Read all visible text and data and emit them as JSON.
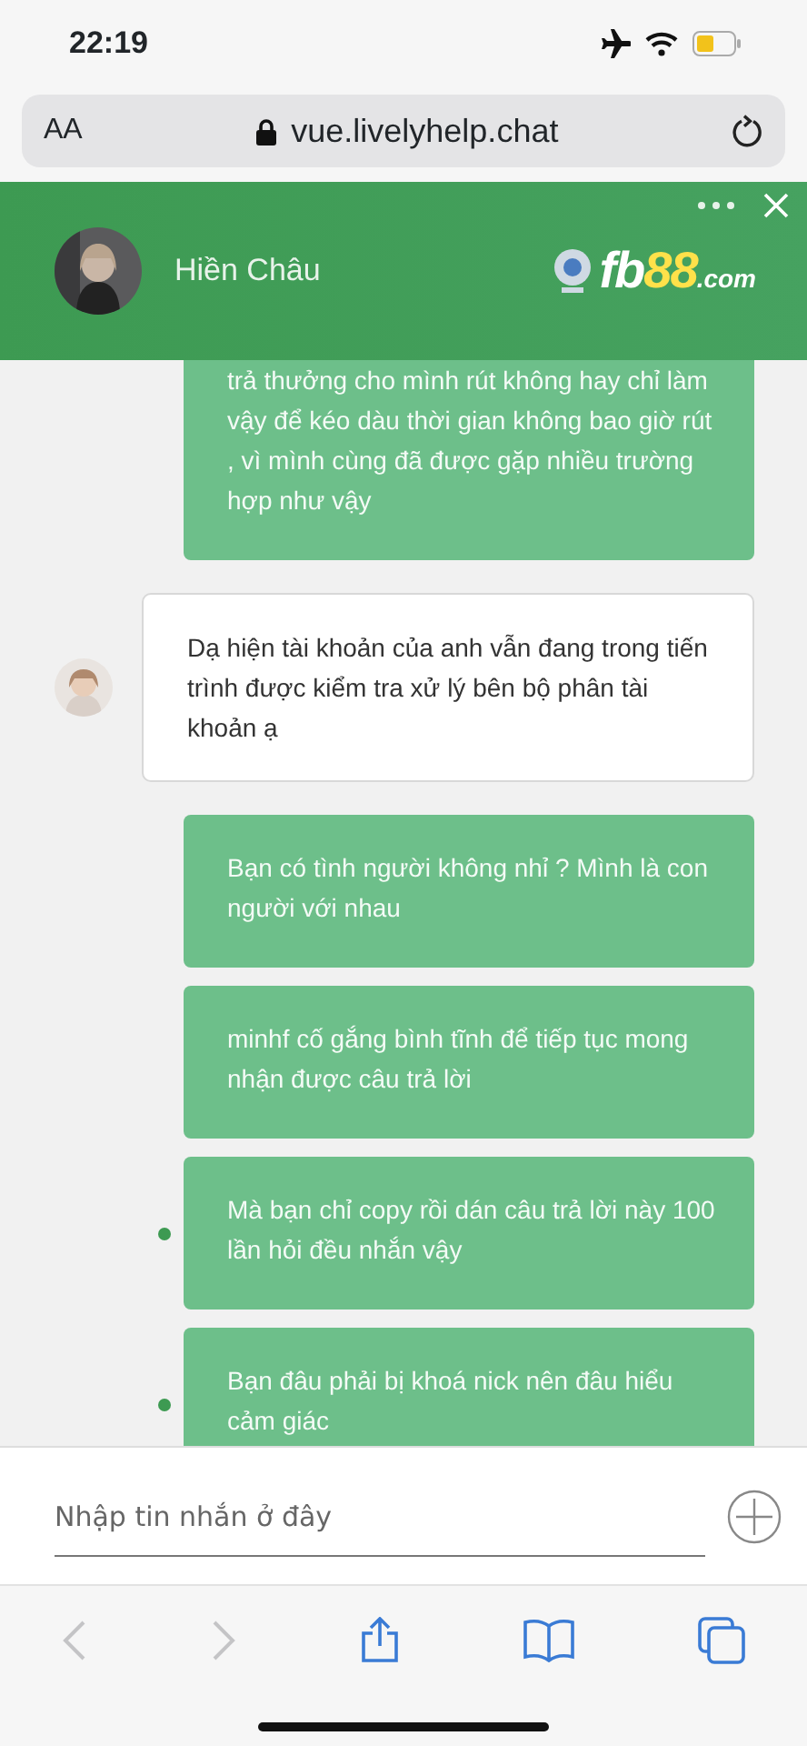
{
  "status_bar": {
    "time": "22:19"
  },
  "browser": {
    "text_size_button": "AA",
    "url": "vue.livelyhelp.chat"
  },
  "chat_header": {
    "agent_name": "Hiền Châu",
    "logo": {
      "part_1": "fb",
      "part_2": "88",
      "part_3": ".com"
    }
  },
  "messages": [
    {
      "kind": "visitor",
      "text": "trả thưởng cho mình rút không hay chỉ làm vậy để kéo dàu thời gian không bao giờ rút , vì mình cùng đã được gặp nhiều trường hợp như vậy",
      "status_dot": false
    },
    {
      "kind": "operator",
      "text": "Dạ hiện tài khoản của anh vẫn đang trong tiến trình được kiểm tra xử lý bên bộ phân tài khoản ạ",
      "status_dot": false
    },
    {
      "kind": "visitor",
      "text": "Bạn có tình người không nhỉ ? Mình là con người với nhau",
      "status_dot": false
    },
    {
      "kind": "visitor",
      "text": "minhf cố gắng bình tĩnh để tiếp tục mong nhận được câu trả lời",
      "status_dot": false
    },
    {
      "kind": "visitor",
      "text": "Mà bạn chỉ copy rồi dán câu trả lời này 100 lần hỏi đều nhắn vậy",
      "status_dot": true
    },
    {
      "kind": "visitor",
      "text": "Bạn đâu phải bị khoá nick nên đâu hiểu cảm giác",
      "status_dot": true
    }
  ],
  "composer": {
    "placeholder": "Nhập tin nhắn ở đây"
  },
  "toolbar": {
    "back_disabled": true,
    "forward_disabled": true
  }
}
